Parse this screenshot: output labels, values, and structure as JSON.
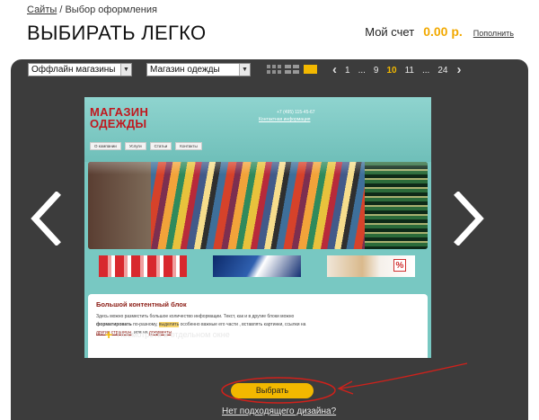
{
  "breadcrumb": {
    "link": "Сайты",
    "separator": " / ",
    "current": "Выбор оформления"
  },
  "header": {
    "title": "ВЫБИРАТЬ ЛЕГКО"
  },
  "account": {
    "label": "Мой счет",
    "amount": "0.00 р.",
    "topup": "Пополнить"
  },
  "filters": {
    "category": "Оффлайн магазины",
    "template": "Магазин одежды"
  },
  "pagination": {
    "pages": [
      "1",
      "...",
      "9",
      "10",
      "11",
      "...",
      "24"
    ],
    "current": "10"
  },
  "preview": {
    "logo_line1": "МАГАЗИН",
    "logo_line2": "ОДЕЖДЫ",
    "phone": "+7 (495) 115-45-67",
    "contact_link": "Контактная информация",
    "nav": [
      "О компании",
      "Услуги",
      "Статьи",
      "Контакты"
    ],
    "content_title": "Большой контентный блок",
    "content_text_1": "Здесь можно разместить большое количество информации. Текст, как и в другие блоки можно",
    "content_text_2a": "форматировать",
    "content_text_2b": " по-разному, ",
    "content_text_2c": "выделить",
    "content_text_2d": " особенно важные его части , вставлять картинки, ссылки на",
    "content_text_3a": "другие страницы",
    "content_text_3b": ", или на ",
    "content_text_3c": "документы"
  },
  "actions": {
    "open_new": "Посмотреть в отдельном окне",
    "choose": "Выбрать",
    "no_design": "Нет подходящего дизайна?"
  },
  "colors": {
    "accent": "#f2b800",
    "stage": "#3c3c3c",
    "annotation": "#d0211b"
  }
}
